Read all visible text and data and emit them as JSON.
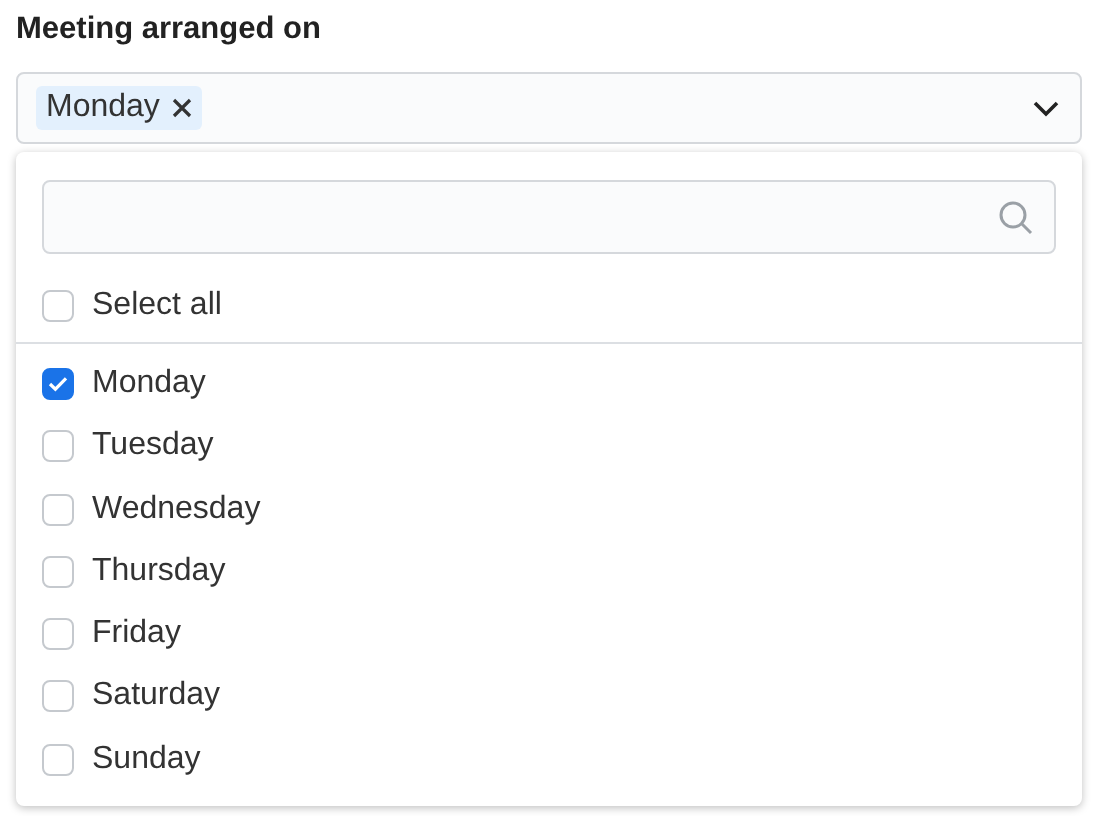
{
  "field": {
    "label": "Meeting arranged on",
    "tags": [
      "Monday"
    ]
  },
  "dropdown": {
    "select_all": {
      "label": "Select all",
      "checked": false
    },
    "options": [
      {
        "label": "Monday",
        "checked": true
      },
      {
        "label": "Tuesday",
        "checked": false
      },
      {
        "label": "Wednesday",
        "checked": false
      },
      {
        "label": "Thursday",
        "checked": false
      },
      {
        "label": "Friday",
        "checked": false
      },
      {
        "label": "Saturday",
        "checked": false
      },
      {
        "label": "Sunday",
        "checked": false
      }
    ]
  }
}
